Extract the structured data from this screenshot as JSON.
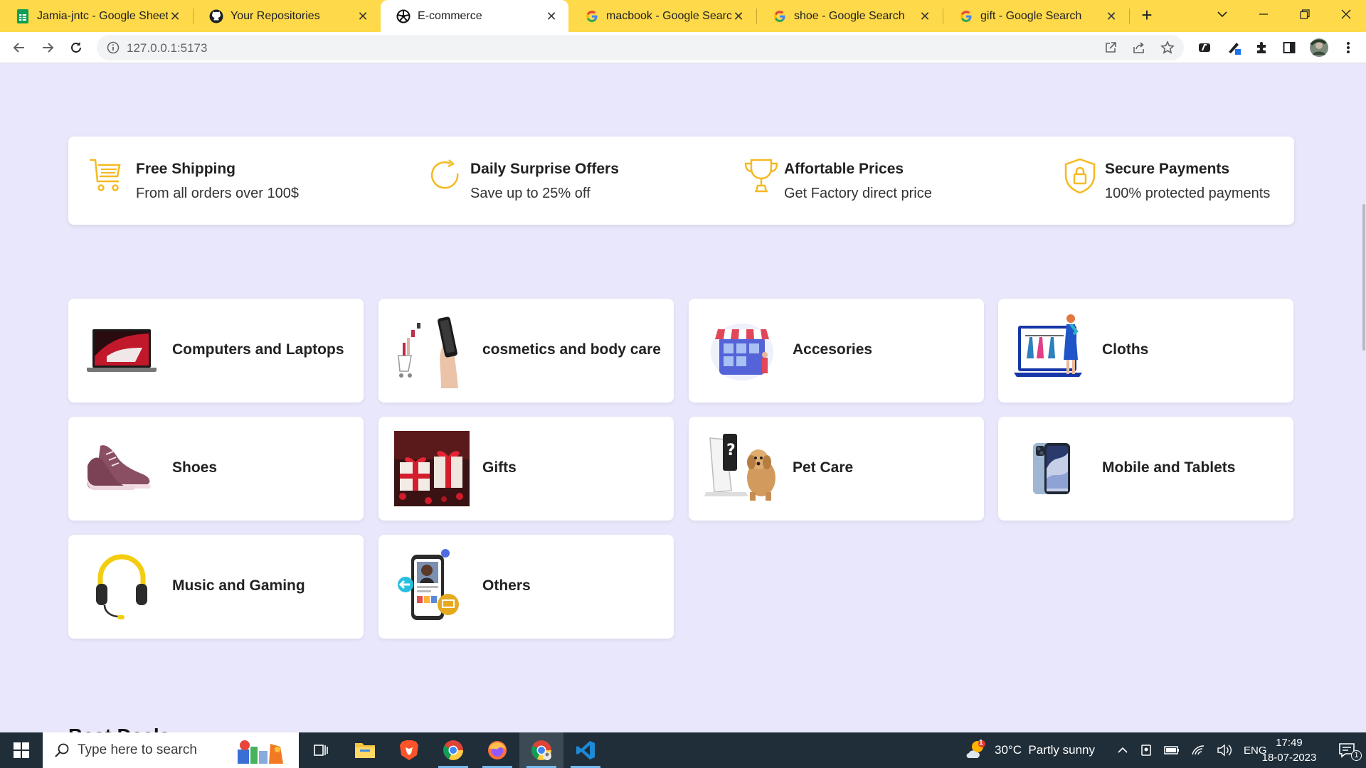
{
  "browser": {
    "tabs": [
      {
        "title": "Jamia-jntc - Google Sheets",
        "icon": "google-sheets-icon",
        "active": false
      },
      {
        "title": "Your Repositories",
        "icon": "github-icon",
        "active": false
      },
      {
        "title": "E-commerce",
        "icon": "ecommerce-favicon",
        "active": true
      },
      {
        "title": "macbook - Google Search",
        "icon": "google-icon",
        "active": false
      },
      {
        "title": "shoe - Google Search",
        "icon": "google-icon",
        "active": false
      },
      {
        "title": "gift - Google Search",
        "icon": "google-icon",
        "active": false
      }
    ],
    "tab_close_glyph": "✕",
    "new_tab_glyph": "+",
    "url": "127.0.0.1:5173",
    "accent_color": "#fed94a"
  },
  "features": [
    {
      "title": "Free Shipping",
      "subtitle": "From all orders over 100$",
      "icon": "cart-icon"
    },
    {
      "title": "Daily Surprise Offers",
      "subtitle": "Save up to 25% off",
      "icon": "refresh-icon"
    },
    {
      "title": "Affortable Prices",
      "subtitle": "Get Factory direct price",
      "icon": "trophy-icon"
    },
    {
      "title": "Secure Payments",
      "subtitle": "100% protected payments",
      "icon": "shield-lock-icon"
    }
  ],
  "categories": [
    {
      "label": "Computers and Laptops",
      "image": "laptop-image"
    },
    {
      "label": "cosmetics and body care",
      "image": "cosmetics-image"
    },
    {
      "label": "Accesories",
      "image": "accessories-shop-image"
    },
    {
      "label": "Cloths",
      "image": "clothes-laptop-image"
    },
    {
      "label": "Shoes",
      "image": "sneaker-image"
    },
    {
      "label": "Gifts",
      "image": "gift-boxes-image"
    },
    {
      "label": "Pet Care",
      "image": "pet-care-image"
    },
    {
      "label": "Mobile and Tablets",
      "image": "smartphone-image"
    },
    {
      "label": "Music and Gaming",
      "image": "headphones-image"
    },
    {
      "label": "Others",
      "image": "mobile-shopping-image"
    }
  ],
  "next_section_peek": "Best Deals",
  "taskbar": {
    "search_placeholder": "Type here to search",
    "weather": "30°C  Partly sunny",
    "weather_badge": "1",
    "language": "ENG",
    "time": "17:49",
    "date": "18-07-2023",
    "notification_count": "1"
  },
  "colors": {
    "page_background": "#e8e7fb",
    "feature_icon": "#f5b921",
    "taskbar": "#1f2e39"
  }
}
